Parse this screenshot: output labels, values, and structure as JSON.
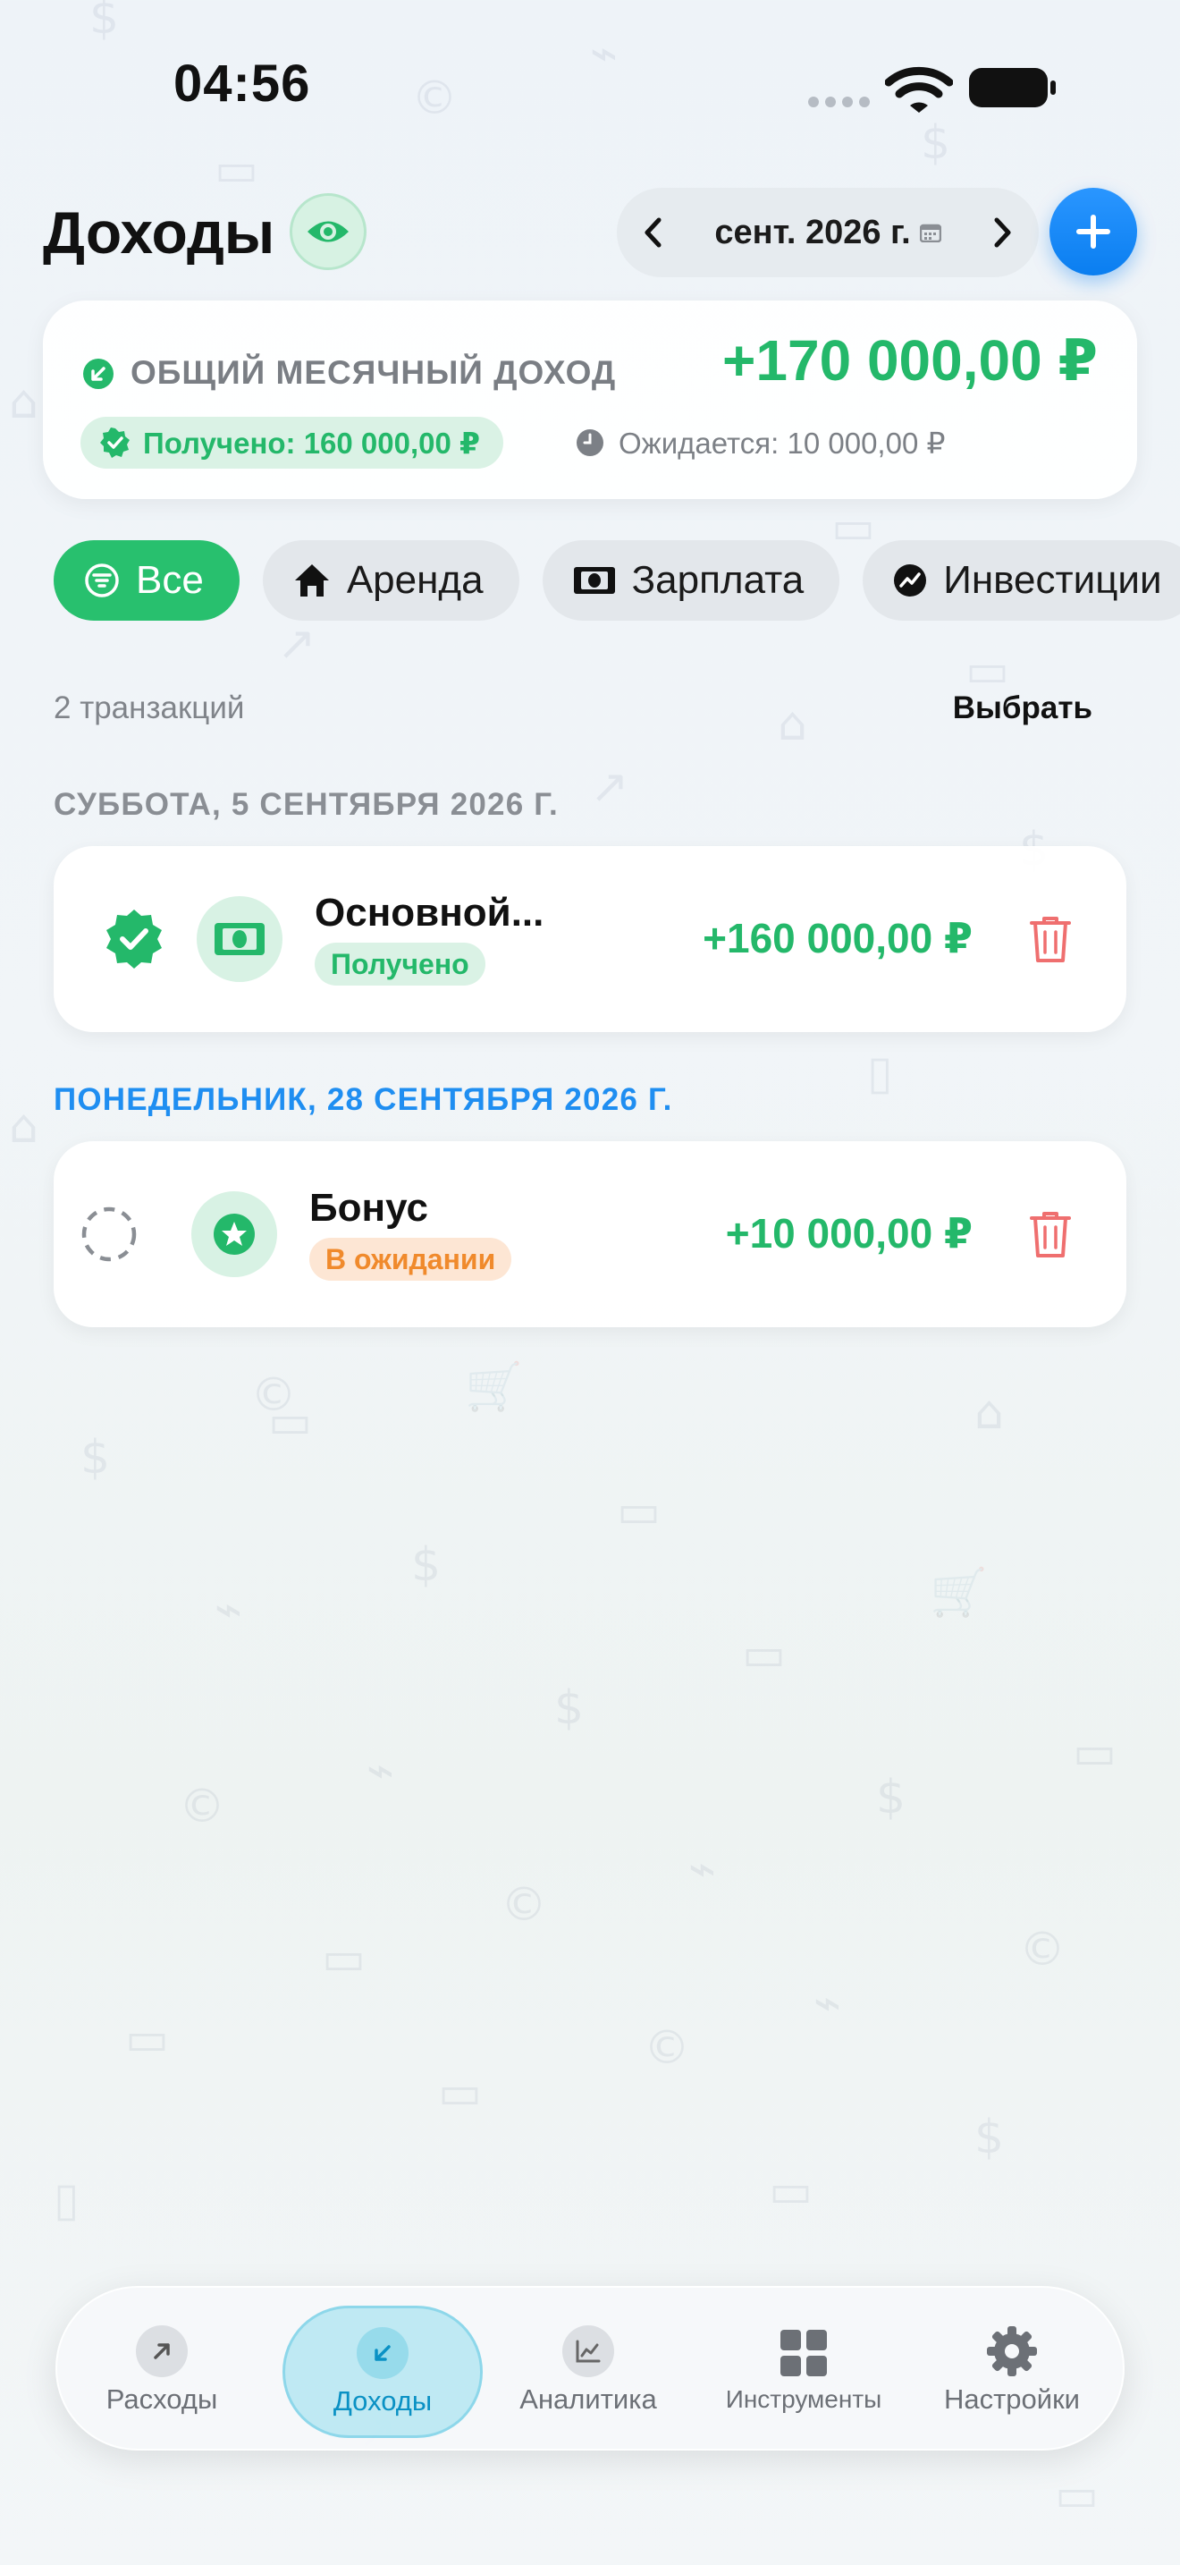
{
  "status_bar": {
    "time": "04:56"
  },
  "header": {
    "title": "Доходы",
    "month": "сент. 2026 г."
  },
  "summary": {
    "label": "ОБЩИЙ МЕСЯЧНЫЙ ДОХОД",
    "amount": "+170 000,00 ₽",
    "received": "Получено: 160 000,00 ₽",
    "expected": "Ожидается: 10 000,00 ₽"
  },
  "filters": [
    {
      "label": "Все",
      "icon": "filter-icon",
      "active": true
    },
    {
      "label": "Аренда",
      "icon": "house-icon"
    },
    {
      "label": "Зарплата",
      "icon": "banknote-icon"
    },
    {
      "label": "Инвестиции",
      "icon": "chart-icon"
    }
  ],
  "list": {
    "count": "2 транзакций",
    "select_label": "Выбрать"
  },
  "sections": [
    {
      "header": "СУББОТА, 5 СЕНТЯБРЯ 2026 Г.",
      "transactions": [
        {
          "title": "Основной...",
          "status": "Получено",
          "amount": "+160 000,00 ₽",
          "icon": "banknote-icon"
        }
      ]
    },
    {
      "header": "ПОНЕДЕЛЬНИК, 28 СЕНТЯБРЯ 2026 Г.",
      "transactions": [
        {
          "title": "Бонус",
          "status": "В ожидании",
          "amount": "+10 000,00 ₽",
          "icon": "star-icon"
        }
      ]
    }
  ],
  "tab_bar": [
    {
      "label": "Расходы",
      "icon": "arrow-up-right-icon"
    },
    {
      "label": "Доходы",
      "icon": "arrow-down-left-icon",
      "active": true
    },
    {
      "label": "Аналитика",
      "icon": "chart-icon"
    },
    {
      "label": "Инструменты",
      "icon": "grid-icon"
    },
    {
      "label": "Настройки",
      "icon": "gear-icon"
    }
  ],
  "colors": {
    "green": "#24b86a",
    "blue": "#1f8ef1",
    "orange": "#f08a2c",
    "red": "#ef6f6f"
  }
}
